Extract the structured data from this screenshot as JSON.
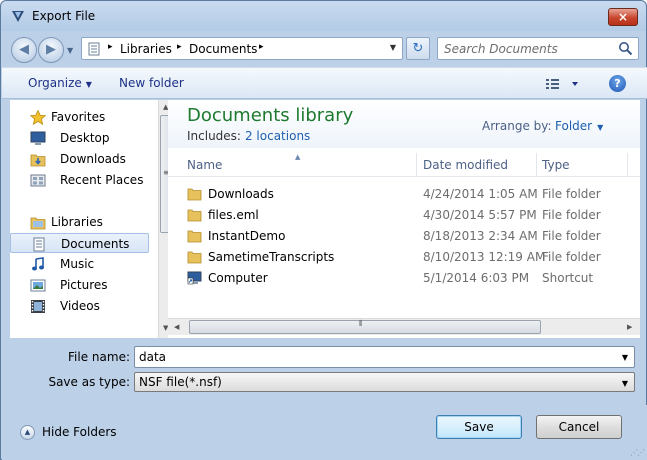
{
  "window": {
    "title": "Export File",
    "close_glyph": "×"
  },
  "nav": {
    "back_glyph": "◀",
    "forward_glyph": "▶",
    "refresh_glyph": "↻"
  },
  "address": {
    "breadcrumbs": [
      "Libraries",
      "Documents"
    ],
    "crumb_separator": "▸",
    "dropdown_glyph": "▼"
  },
  "search": {
    "placeholder": "Search Documents"
  },
  "toolbar": {
    "organize_label": "Organize",
    "new_folder_label": "New folder",
    "help_glyph": "?",
    "caret_glyph": "▼"
  },
  "sidebar": {
    "favorites": {
      "label": "Favorites",
      "items": [
        {
          "label": "Desktop",
          "icon": "desktop-icon"
        },
        {
          "label": "Downloads",
          "icon": "downloads-folder-icon"
        },
        {
          "label": "Recent Places",
          "icon": "recent-places-icon"
        }
      ]
    },
    "libraries": {
      "label": "Libraries",
      "items": [
        {
          "label": "Documents",
          "icon": "documents-icon",
          "selected": true
        },
        {
          "label": "Music",
          "icon": "music-icon"
        },
        {
          "label": "Pictures",
          "icon": "pictures-icon"
        },
        {
          "label": "Videos",
          "icon": "videos-icon"
        }
      ]
    }
  },
  "library": {
    "title": "Documents library",
    "includes_label": "Includes:",
    "locations_link": "2 locations",
    "arrange_label": "Arrange by:",
    "arrange_value": "Folder"
  },
  "columns": {
    "name": "Name",
    "date": "Date modified",
    "type": "Type"
  },
  "files": [
    {
      "name": "Downloads",
      "date": "4/24/2014 1:05 AM",
      "type": "File folder",
      "icon": "folder-icon"
    },
    {
      "name": "files.eml",
      "date": "4/30/2014 5:57 PM",
      "type": "File folder",
      "icon": "folder-icon"
    },
    {
      "name": "InstantDemo",
      "date": "8/18/2013 2:34 AM",
      "type": "File folder",
      "icon": "folder-icon"
    },
    {
      "name": "SametimeTranscripts",
      "date": "8/10/2013 12:19 AM",
      "type": "File folder",
      "icon": "folder-icon"
    },
    {
      "name": "Computer",
      "date": "5/1/2014 6:03 PM",
      "type": "Shortcut",
      "icon": "computer-shortcut-icon"
    }
  ],
  "form": {
    "file_name_label": "File name:",
    "file_name_value": "data",
    "save_type_label": "Save as type:",
    "save_type_value": "NSF file(*.nsf)"
  },
  "footer": {
    "hide_folders_label": "Hide Folders",
    "save_label": "Save",
    "cancel_label": "Cancel"
  },
  "colors": {
    "accent_blue": "#1e5fb0",
    "library_green": "#1e7a2e",
    "frame": "#bcd0e8"
  }
}
